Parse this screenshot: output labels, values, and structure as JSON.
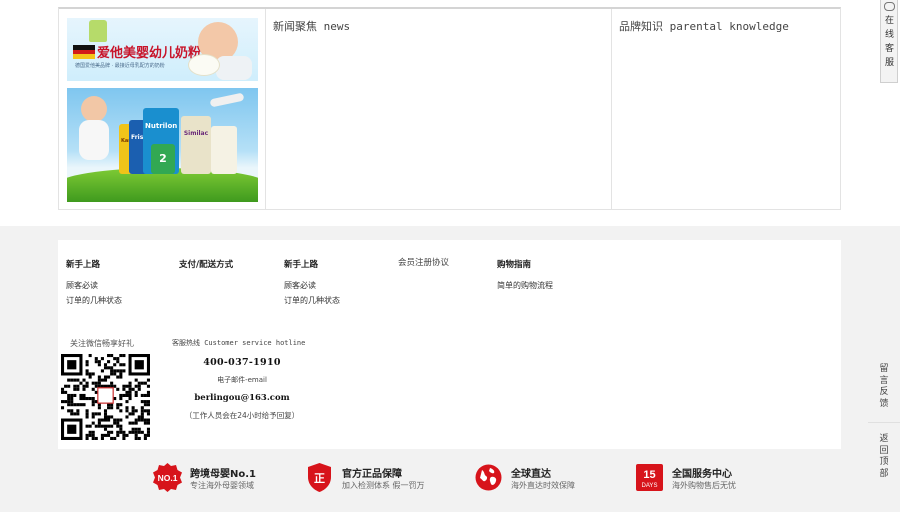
{
  "banners": {
    "banner1": {
      "title": "爱他美婴幼儿奶粉",
      "subtitle": "德国爱他美品牌 · 最接近母乳配方的奶粉",
      "brand_colors": {
        "flag_black": "#111111",
        "flag_red": "#d21a1a",
        "flag_gold": "#f4c31b"
      }
    },
    "banner2": {
      "cans": [
        {
          "label": "Karicare",
          "color": "#f0c419"
        },
        {
          "label": "Friso",
          "color": "#1b5fb0"
        },
        {
          "label": "Nutrilon",
          "color": "#1a8fcf"
        },
        {
          "label": "2",
          "color": "#32a853"
        },
        {
          "label": "Similac",
          "color": "#e9e3c9"
        },
        {
          "label": "",
          "color": "#f5f2e4"
        }
      ]
    }
  },
  "columns": {
    "news_title": "新闻聚焦 news",
    "brand_title": "品牌知识 parental knowledge"
  },
  "side_tab": {
    "label": "在线客服"
  },
  "footer": {
    "columns": [
      {
        "heading": "新手上路",
        "heading_bold": true,
        "links": [
          "顾客必读",
          "订单的几种状态"
        ]
      },
      {
        "heading": "支付/配送方式",
        "heading_bold": true,
        "links": []
      },
      {
        "heading": "新手上路",
        "heading_bold": true,
        "links": [
          "顾客必读",
          "订单的几种状态"
        ]
      },
      {
        "heading": "会员注册协议",
        "heading_bold": false,
        "links": []
      },
      {
        "heading": "购物指南",
        "heading_bold": true,
        "links": [
          "简单的购物流程"
        ]
      }
    ],
    "follow_label": "关注微信畅享好礼",
    "service": {
      "title": "客服热线 Customer service hotline",
      "phone": "400-037-1910",
      "email_label": "电子邮件-email",
      "email": "berlingou@163.com",
      "note": "（工作人员会在24小时给予回复）"
    }
  },
  "features": [
    {
      "title": "跨境母婴No.1",
      "subtitle": "专注海外母婴领域",
      "badge": "NO.1",
      "icon": "no1-badge-icon",
      "color": "#d7141b"
    },
    {
      "title": "官方正品保障",
      "subtitle": "加入检测体系  假一罚万",
      "badge": "正",
      "icon": "shield-genuine-icon",
      "color": "#d7141b"
    },
    {
      "title": "全球直达",
      "subtitle": "海外直达时效保障",
      "badge": "",
      "icon": "globe-icon",
      "color": "#d7141b"
    },
    {
      "title": "全国服务中心",
      "subtitle": "海外购物售后无忧",
      "badge": "15",
      "badge_sub": "DAYS",
      "icon": "calendar-15-days-icon",
      "color": "#d7141b"
    }
  ],
  "right_links": {
    "feedback": "留言反馈",
    "back_to_top": "返回顶部"
  }
}
